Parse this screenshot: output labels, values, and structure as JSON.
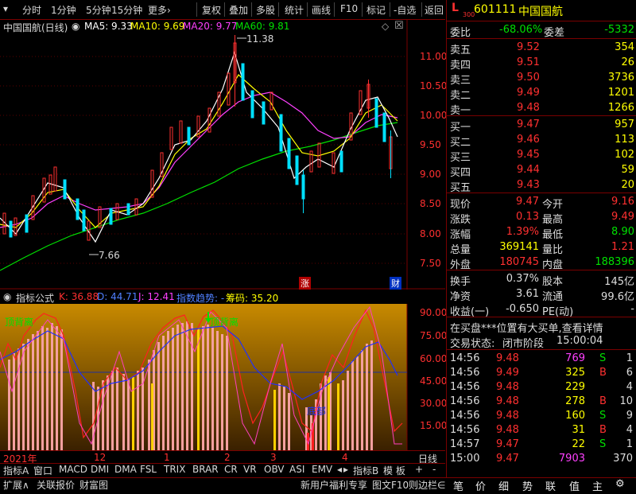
{
  "toolbar": {
    "items": [
      "分时",
      "1分钟",
      "5分钟",
      "15分钟",
      "更多›",
      "复权",
      "叠加",
      "多股",
      "统计",
      "画线",
      "F10",
      "标记",
      "-自选",
      "返回"
    ]
  },
  "chart": {
    "title": "中国国航(日线)",
    "ma5": "MA5: 9.33",
    "ma10": "MA10: 9.69",
    "ma20": "MA20: 9.77",
    "ma60": "MA60: 9.81",
    "high_label": "11.38",
    "low_label": "7.66",
    "y_ticks": [
      "11.00",
      "10.50",
      "10.00",
      "9.50",
      "9.00",
      "8.50",
      "8.00",
      "7.50"
    ],
    "badge_zhang": "涨",
    "badge_cai": "财",
    "colors": {
      "up": "#ff3030",
      "down": "#00e0ff",
      "ma5": "#ffffff",
      "ma10": "#ffff00",
      "ma20": "#ff40ff",
      "ma60": "#00e000"
    }
  },
  "indicator": {
    "label": "指标公式",
    "k": "K: 36.88",
    "d": "D: 44.71",
    "j": "J: 12.41",
    "trend": "指数趋势: -",
    "chip": "筹码: 35.20",
    "ding1": "顶背离",
    "ding2": "顶背离",
    "di": "底部",
    "y_ticks": [
      "90.00",
      "75.00",
      "60.00",
      "45.00",
      "30.00",
      "15.00"
    ]
  },
  "time_axis": {
    "labels": [
      "2021年",
      "12",
      "1",
      "2",
      "3",
      "4"
    ],
    "period": "日线"
  },
  "indicator_tabs": [
    "指标A",
    "窗口",
    "MACD",
    "DMI",
    "DMA",
    "FSL",
    "TRIX",
    "BRAR",
    "CR",
    "VR",
    "OBV",
    "ASI",
    "EMV"
  ],
  "indicator_tabs_right": [
    "指标B",
    "模 板",
    "+",
    "-"
  ],
  "bottom_tabs": [
    "扩展∧",
    "关联报价",
    "财富图"
  ],
  "bottom_ad": "新用户福利专享",
  "bottom_more": [
    "图文F10",
    "则边栏∈"
  ],
  "stock": {
    "prefix": "L",
    "sub": "300",
    "code": "601111",
    "name": "中国国航",
    "weibi_label": "委比",
    "weibi": "-68.06%",
    "weicha_label": "委差",
    "weicha": "-5332",
    "asks": [
      {
        "label": "卖五",
        "price": "9.52",
        "vol": "354"
      },
      {
        "label": "卖四",
        "price": "9.51",
        "vol": "26"
      },
      {
        "label": "卖三",
        "price": "9.50",
        "vol": "3736"
      },
      {
        "label": "卖二",
        "price": "9.49",
        "vol": "1201"
      },
      {
        "label": "卖一",
        "price": "9.48",
        "vol": "1266"
      }
    ],
    "bids": [
      {
        "label": "买一",
        "price": "9.47",
        "vol": "957"
      },
      {
        "label": "买二",
        "price": "9.46",
        "vol": "113"
      },
      {
        "label": "买三",
        "price": "9.45",
        "vol": "102"
      },
      {
        "label": "买四",
        "price": "9.44",
        "vol": "59"
      },
      {
        "label": "买五",
        "price": "9.43",
        "vol": "20"
      }
    ],
    "quote": [
      {
        "l1": "现价",
        "v1": "9.47",
        "l2": "今开",
        "v2": "9.16"
      },
      {
        "l1": "涨跌",
        "v1": "0.13",
        "l2": "最高",
        "v2": "9.49"
      },
      {
        "l1": "涨幅",
        "v1": "1.39%",
        "l2": "最低",
        "v2": "8.90"
      },
      {
        "l1": "总量",
        "v1": "369141",
        "l2": "量比",
        "v2": "1.21"
      },
      {
        "l1": "外盘",
        "v1": "180745",
        "l2": "内盘",
        "v2": "188396"
      }
    ],
    "finance": [
      {
        "l1": "换手",
        "v1": "0.37%",
        "l2": "股本",
        "v2": "145亿"
      },
      {
        "l1": "净资",
        "v1": "3.61",
        "l2": "流通",
        "v2": "99.6亿"
      },
      {
        "l1": "收益(一)",
        "v1": "-0.650",
        "l2": "PE(动)",
        "v2": "-"
      }
    ],
    "notice": "在买盘***位置有大买单,查看详情",
    "status_label": "交易状态:",
    "status": "闭市阶段",
    "status_time": "15:00:04",
    "ticks": [
      {
        "t": "14:56",
        "p": "9.48",
        "v": "769",
        "s": "S",
        "n": "1"
      },
      {
        "t": "14:56",
        "p": "9.49",
        "v": "325",
        "s": "B",
        "n": "6"
      },
      {
        "t": "14:56",
        "p": "9.48",
        "v": "229",
        "s": "",
        "n": "4"
      },
      {
        "t": "14:56",
        "p": "9.48",
        "v": "278",
        "s": "B",
        "n": "10"
      },
      {
        "t": "14:56",
        "p": "9.48",
        "v": "160",
        "s": "S",
        "n": "9"
      },
      {
        "t": "14:56",
        "p": "9.48",
        "v": "31",
        "s": "B",
        "n": "4"
      },
      {
        "t": "14:57",
        "p": "9.47",
        "v": "22",
        "s": "S",
        "n": "1"
      },
      {
        "t": "15:00",
        "p": "9.47",
        "v": "7903",
        "s": "",
        "n": "370"
      }
    ],
    "right_tabs": [
      "笔",
      "价",
      "细",
      "势",
      "联",
      "值",
      "主",
      "⚙"
    ]
  }
}
